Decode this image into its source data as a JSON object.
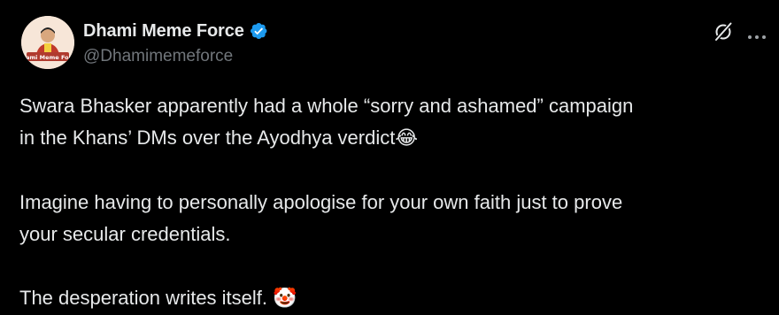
{
  "author": {
    "display_name": "Dhami Meme Force",
    "handle": "@Dhamimemeforce",
    "avatar_text": "Dhami Meme Force",
    "verified_color": "#1d9bf0"
  },
  "actions": {
    "grok_icon": "grok-icon",
    "more_icon": "more-icon"
  },
  "tweet": {
    "line1": "Swara Bhasker apparently had a whole “sorry and ashamed” campaign",
    "line2": "in the Khans’ DMs over the Ayodhya verdict",
    "emoji1": "😂",
    "line3": "Imagine having to personally apologise for your own faith just to prove",
    "line4": "your secular credentials.",
    "line5": "The desperation writes itself. ",
    "emoji2": "🤡"
  },
  "colors": {
    "background": "#000000",
    "text": "#e7e9ea",
    "secondary": "#71767b"
  }
}
